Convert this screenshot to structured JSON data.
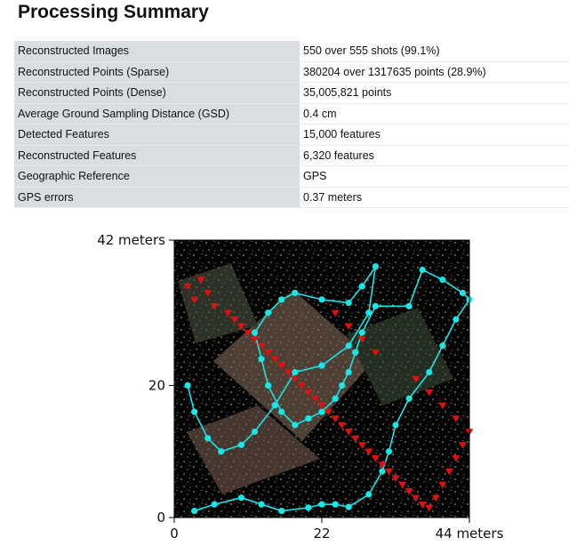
{
  "page": {
    "title": "Processing Summary"
  },
  "summary_rows": [
    {
      "label": "Reconstructed Images",
      "value": "550 over 555 shots (99.1%)"
    },
    {
      "label": "Reconstructed Points (Sparse)",
      "value": "380204 over 1317635 points (28.9%)"
    },
    {
      "label": "Reconstructed Points (Dense)",
      "value": "35,005,821 points"
    },
    {
      "label": "Average Ground Sampling Distance (GSD)",
      "value": "0.4 cm"
    },
    {
      "label": "Detected Features",
      "value": "15,000 features"
    },
    {
      "label": "Reconstructed Features",
      "value": "6,320 features"
    },
    {
      "label": "Geographic Reference",
      "value": "GPS"
    },
    {
      "label": "GPS errors",
      "value": "0.37 meters"
    }
  ],
  "chart_data": {
    "type": "scatter",
    "title": "",
    "xlabel": "",
    "ylabel": "",
    "xlim": [
      0,
      44
    ],
    "ylim": [
      0,
      42
    ],
    "x_tick_labels": [
      "0",
      "22",
      "44 meters"
    ],
    "y_tick_labels": [
      "0",
      "20",
      "42 meters"
    ],
    "x_ticks": [
      0,
      22,
      44
    ],
    "y_ticks": [
      0,
      20,
      42
    ],
    "background": "#000000",
    "series": [
      {
        "marker": "circle",
        "color": "#19e6e6",
        "x": [
          3,
          6,
          10,
          13,
          16,
          20,
          22,
          24,
          26,
          29,
          31,
          32,
          33,
          35,
          38,
          40,
          42,
          44,
          43,
          40,
          37,
          35,
          30,
          28,
          27,
          26,
          25,
          24,
          22,
          20,
          18,
          16,
          14,
          13,
          12,
          14,
          16,
          18,
          22,
          26,
          28,
          30,
          29,
          26,
          22,
          18,
          15,
          12,
          10,
          7,
          5,
          3,
          2
        ],
        "y": [
          1,
          2,
          3,
          2,
          1,
          1.5,
          2,
          2,
          1.6,
          3.5,
          7,
          10,
          14,
          18,
          22,
          26,
          30,
          33,
          34,
          36,
          37.5,
          32,
          32,
          28,
          25,
          22,
          20,
          18,
          16,
          15,
          14,
          16,
          20,
          24,
          28,
          31,
          33,
          34,
          33,
          32.5,
          35,
          38,
          31,
          26,
          23,
          22,
          17,
          13,
          11,
          10,
          12,
          16,
          20
        ]
      },
      {
        "marker": "triangle-down",
        "color": "#e01010",
        "x": [
          2,
          3,
          4,
          5,
          6,
          8,
          9,
          10,
          11,
          12,
          13,
          14,
          15,
          16,
          17,
          18,
          19,
          20,
          21,
          22,
          23,
          24,
          25,
          26,
          27,
          28,
          29,
          30,
          31,
          32,
          33,
          34,
          35,
          36,
          37,
          38,
          39,
          40,
          41,
          42,
          43,
          44,
          42,
          40,
          38,
          36,
          30,
          28,
          26,
          24
        ],
        "y": [
          35,
          33,
          36,
          34,
          32,
          31,
          30,
          29,
          28,
          27,
          26,
          25,
          24,
          23,
          22,
          21,
          20,
          19,
          18,
          17,
          16,
          15,
          14,
          13,
          12,
          11,
          10,
          9,
          8,
          7,
          6,
          5,
          4,
          3,
          2,
          1.5,
          3,
          5,
          7,
          9,
          11,
          13,
          15,
          17,
          19,
          21,
          25,
          27,
          29,
          31
        ]
      }
    ]
  }
}
